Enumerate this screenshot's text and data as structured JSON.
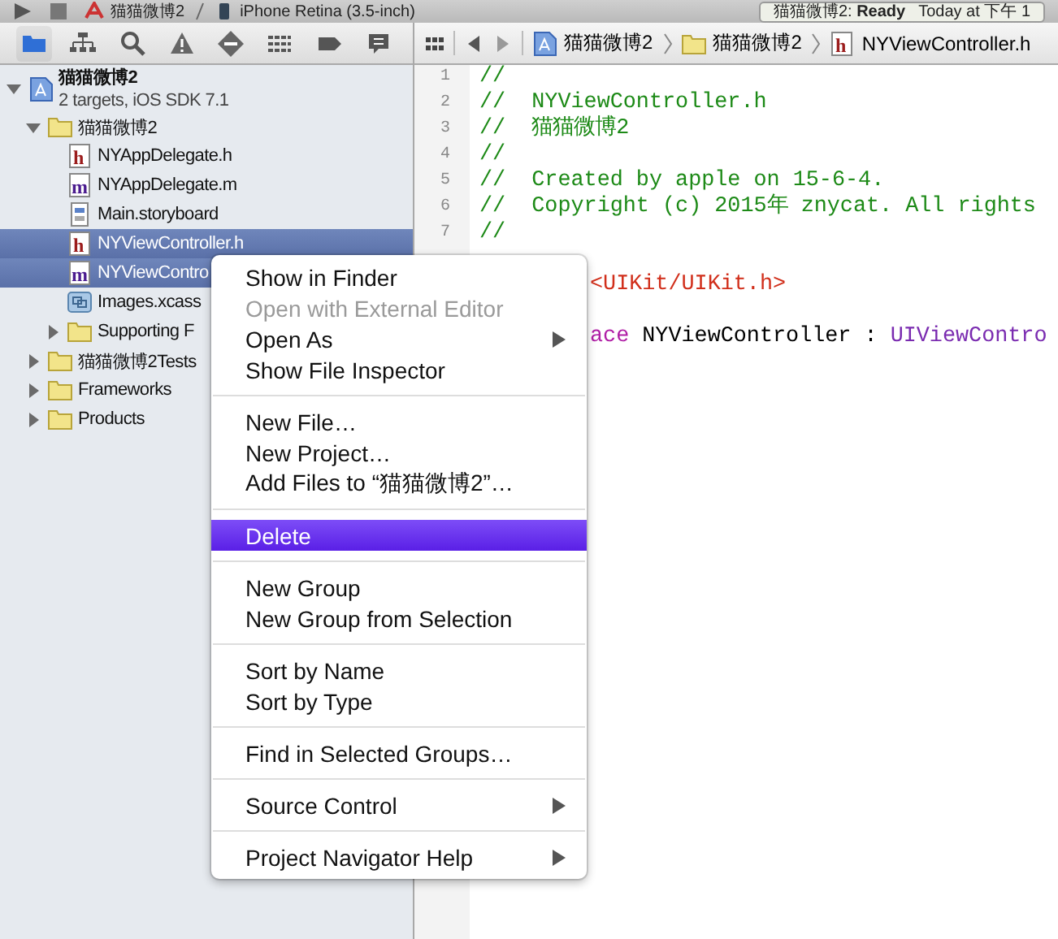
{
  "toolbar": {
    "scheme": "猫猫微博2",
    "destination": "iPhone Retina (3.5-inch)",
    "status": "猫猫微博2: **Ready**",
    "status_time": "Today at 下午 1"
  },
  "navigator_tabs": [
    {
      "kind": "folder",
      "selected": true
    },
    {
      "kind": "hierarchy",
      "selected": false
    },
    {
      "kind": "search",
      "selected": false
    },
    {
      "kind": "warning",
      "selected": false
    },
    {
      "kind": "breakpoint",
      "selected": false
    },
    {
      "kind": "list",
      "selected": false
    },
    {
      "kind": "tag",
      "selected": false
    },
    {
      "kind": "bubble",
      "selected": false
    }
  ],
  "tree": [
    {
      "kind": "project",
      "name": "猫猫微博2",
      "subtitle": "2 targets, iOS SDK 7.1",
      "expanded": true,
      "selected": false,
      "children": [
        {
          "kind": "folder",
          "name": "猫猫微博2",
          "expanded": true,
          "selected": false,
          "children": [
            {
              "kind": "h",
              "name": "NYAppDelegate.h",
              "selected": false
            },
            {
              "kind": "m",
              "name": "NYAppDelegate.m",
              "selected": false
            },
            {
              "kind": "storyboard",
              "name": "Main.storyboard",
              "selected": false
            },
            {
              "kind": "h",
              "name": "NYViewController.h",
              "selected": true
            },
            {
              "kind": "m",
              "name": "NYViewContro",
              "selected": true
            },
            {
              "kind": "xcassets",
              "name": "Images.xcass",
              "selected": false
            },
            {
              "kind": "folder",
              "name": "Supporting F",
              "expanded": false,
              "selected": false
            }
          ]
        },
        {
          "kind": "folder",
          "name": "猫猫微博2Tests",
          "expanded": false,
          "selected": false
        },
        {
          "kind": "folder",
          "name": "Frameworks",
          "expanded": false,
          "selected": false
        },
        {
          "kind": "folder",
          "name": "Products",
          "expanded": false,
          "selected": false
        }
      ]
    }
  ],
  "jump_bar": [
    {
      "kind": "project",
      "label": "猫猫微博2"
    },
    {
      "kind": "folder",
      "label": "猫猫微博2"
    },
    {
      "kind": "h",
      "label": "NYViewController.h"
    }
  ],
  "code": [
    {
      "kind": "line",
      "number": "1",
      "segments": [
        {
          "kind": "comment",
          "text": "//"
        }
      ]
    },
    {
      "kind": "line",
      "number": "2",
      "segments": [
        {
          "kind": "comment",
          "text": "//  NYViewController.h"
        }
      ]
    },
    {
      "kind": "line",
      "number": "3",
      "segments": [
        {
          "kind": "comment",
          "text": "//  猫猫微博2"
        }
      ]
    },
    {
      "kind": "line",
      "number": "4",
      "segments": [
        {
          "kind": "comment",
          "text": "//"
        }
      ]
    },
    {
      "kind": "line",
      "number": "5",
      "segments": [
        {
          "kind": "comment",
          "text": "//  Created by apple on 15-6-4."
        }
      ]
    },
    {
      "kind": "line",
      "number": "6",
      "segments": [
        {
          "kind": "comment",
          "text": "//  Copyright (c) 2015年 znycat. All rights"
        }
      ]
    },
    {
      "kind": "line",
      "number": "7",
      "segments": [
        {
          "kind": "comment",
          "text": "//"
        }
      ]
    },
    {
      "kind": "blank"
    },
    {
      "kind": "covered",
      "segments": [
        {
          "kind": "string",
          "text": "<UIKit/UIKit.h>"
        }
      ]
    },
    {
      "kind": "blank"
    },
    {
      "kind": "covered",
      "segments": [
        {
          "kind": "keyword",
          "text": "ace"
        },
        {
          "kind": "plain",
          "text": " NYViewController : "
        },
        {
          "kind": "class",
          "text": "UIViewContro"
        }
      ]
    }
  ],
  "context_menu": [
    [
      {
        "label": "Show in Finder",
        "disabled": false,
        "selected": false,
        "submenu": false
      },
      {
        "label": "Open with External Editor",
        "disabled": true,
        "selected": false,
        "submenu": false
      },
      {
        "label": "Open As",
        "disabled": false,
        "selected": false,
        "submenu": true
      },
      {
        "label": "Show File Inspector",
        "disabled": false,
        "selected": false,
        "submenu": false
      }
    ],
    [
      {
        "label": "New File…",
        "disabled": false,
        "selected": false,
        "submenu": false
      },
      {
        "label": "New Project…",
        "disabled": false,
        "selected": false,
        "submenu": false
      },
      {
        "label": "Add Files to “猫猫微博2”…",
        "disabled": false,
        "selected": false,
        "submenu": false
      }
    ],
    [
      {
        "label": "Delete",
        "disabled": false,
        "selected": true,
        "submenu": false
      }
    ],
    [
      {
        "label": "New Group",
        "disabled": false,
        "selected": false,
        "submenu": false
      },
      {
        "label": "New Group from Selection",
        "disabled": false,
        "selected": false,
        "submenu": false
      }
    ],
    [
      {
        "label": "Sort by Name",
        "disabled": false,
        "selected": false,
        "submenu": false
      },
      {
        "label": "Sort by Type",
        "disabled": false,
        "selected": false,
        "submenu": false
      }
    ],
    [
      {
        "label": "Find in Selected Groups…",
        "disabled": false,
        "selected": false,
        "submenu": false
      }
    ],
    [
      {
        "label": "Source Control",
        "disabled": false,
        "selected": false,
        "submenu": true
      }
    ],
    [
      {
        "label": "Project Navigator Help",
        "disabled": false,
        "selected": false,
        "submenu": true
      }
    ]
  ]
}
